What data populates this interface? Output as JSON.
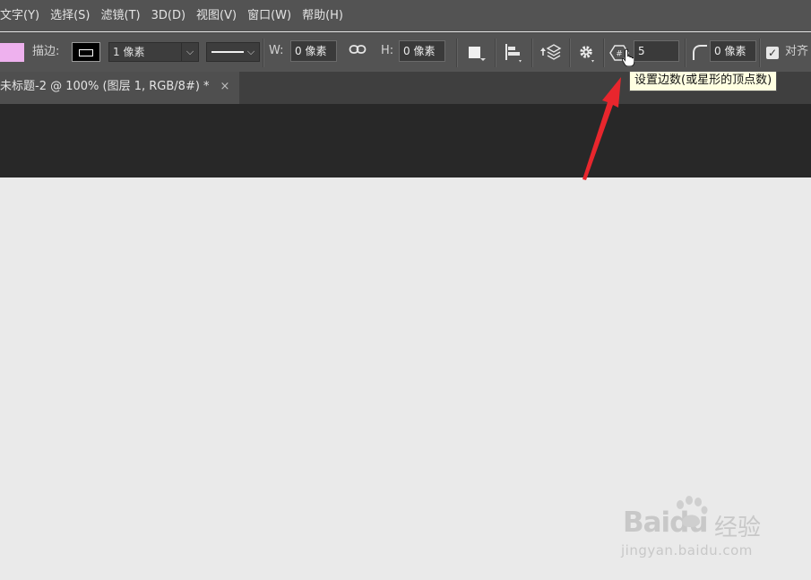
{
  "menubar": {
    "items": [
      "文字(Y)",
      "选择(S)",
      "滤镜(T)",
      "3D(D)",
      "视图(V)",
      "窗口(W)",
      "帮助(H)"
    ]
  },
  "options": {
    "fill_color": "#eeb1ee",
    "stroke_label": "描边:",
    "stroke_width_value": "1 像素",
    "stroke_style": "solid",
    "w_label": "W:",
    "w_value": "0 像素",
    "h_label": "H:",
    "h_value": "0 像素",
    "sides_value": "5",
    "corner_radius_value": "0 像素",
    "align_edges_label": "对齐",
    "align_edges_checked": true,
    "icons": [
      "link-icon",
      "path-operations-icon",
      "path-alignment-icon",
      "path-arrangement-icon",
      "settings-gear-icon",
      "polygon-sides-icon",
      "corner-radius-icon"
    ]
  },
  "tooltip": {
    "text": "设置边数(或星形的顶点数)"
  },
  "document": {
    "tab_title": "未标题-2 @ 100% (图层 1, RGB/8#) *",
    "close_glyph": "×"
  },
  "watermark": {
    "brand": "Baidu",
    "suffix": "经验",
    "url": "jingyan.baidu.com"
  },
  "colors": {
    "annotation_arrow": "#e8262d",
    "canvas": "#eaeaea",
    "toolbar": "#535353"
  }
}
